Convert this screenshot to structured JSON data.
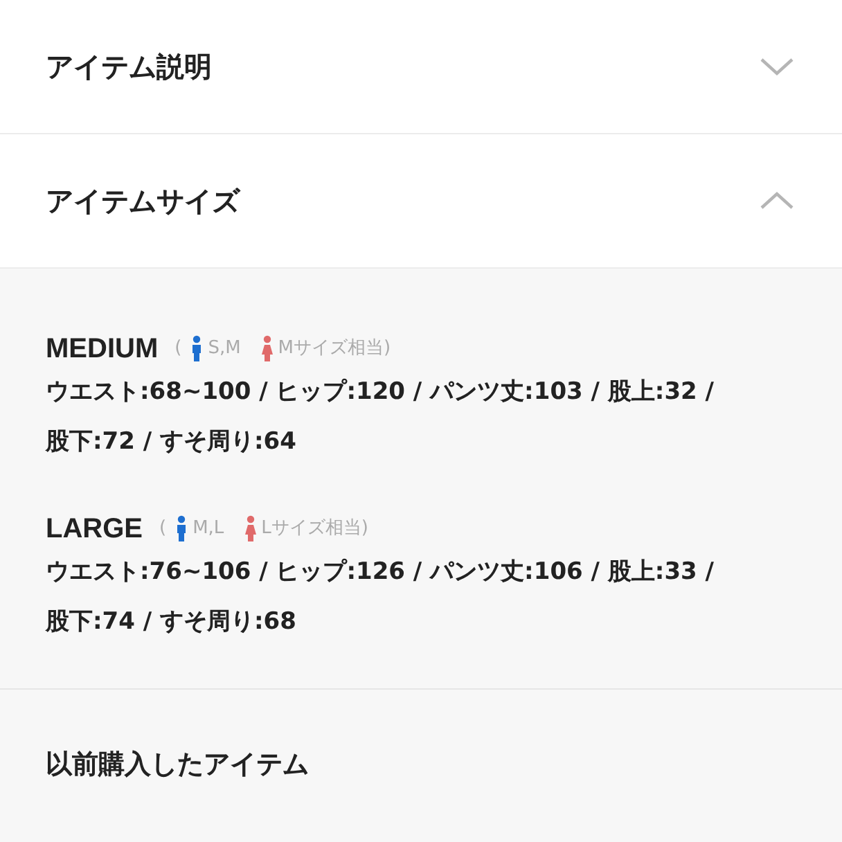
{
  "sections": [
    {
      "title": "アイテム説明",
      "expanded": false
    },
    {
      "title": "アイテムサイズ",
      "expanded": true
    }
  ],
  "sizes": [
    {
      "name": "MEDIUM",
      "open_paren": "(",
      "men": "S,M",
      "women": "Mサイズ相当)",
      "lines": [
        "ウエスト:68~100 / ヒップ:120 / パンツ丈:103 / 股上:32 /",
        "股下:72 / すそ周り:64"
      ]
    },
    {
      "name": "LARGE",
      "open_paren": "(",
      "men": "M,L",
      "women": "Lサイズ相当)",
      "lines": [
        "ウエスト:76~106 / ヒップ:126 / パンツ丈:106 / 股上:33 /",
        "股下:74 / すそ周り:68"
      ]
    }
  ],
  "history": {
    "title": "以前購入したアイテム"
  }
}
